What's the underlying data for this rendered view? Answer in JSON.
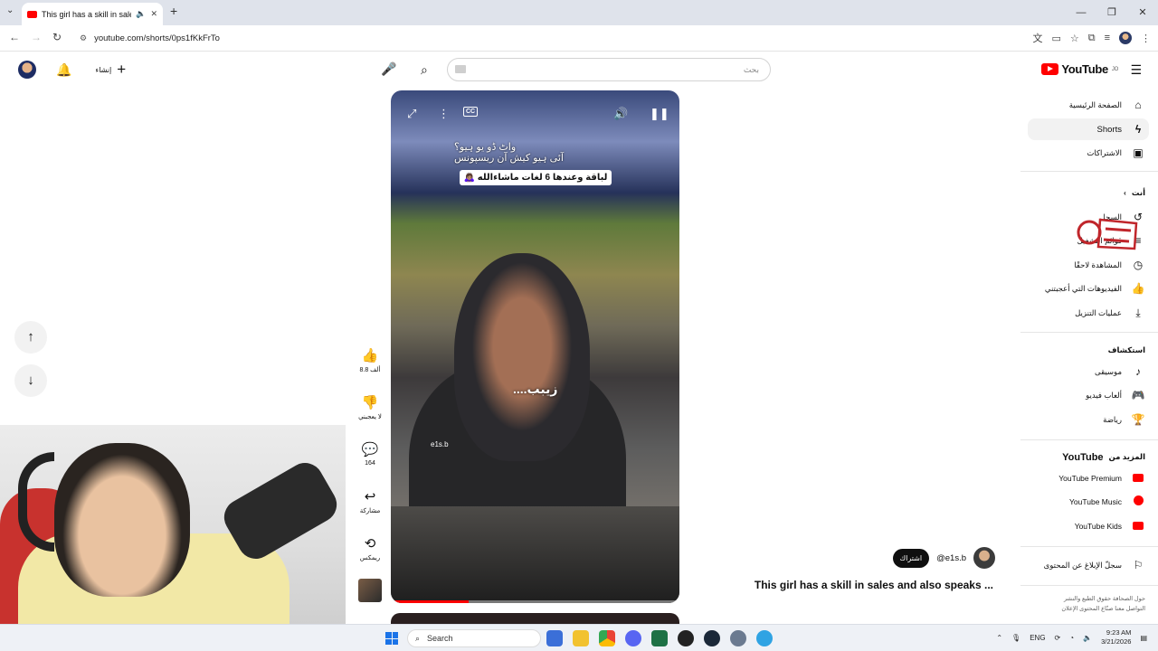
{
  "browser": {
    "tab_title": "This girl has a skill in sales a",
    "url": "youtube.com/shorts/0ps1fKkFrTo",
    "new_tab": "+",
    "window": {
      "minimize": "—",
      "restore": "❐",
      "close": "✕"
    }
  },
  "header": {
    "logo_text": "YouTube",
    "logo_region": "JO",
    "search_placeholder": "بحث",
    "create_label": "إنشاء"
  },
  "sidebar": {
    "main": [
      {
        "label": "الصفحة الرئيسية",
        "icon": "home-icon"
      },
      {
        "label": "Shorts",
        "icon": "shorts-icon",
        "active": true
      },
      {
        "label": "الاشتراكات",
        "icon": "subscriptions-icon"
      }
    ],
    "you_heading": "أنت",
    "you": [
      {
        "label": "السجل",
        "icon": "history-icon"
      },
      {
        "label": "قوائم التشغيل",
        "icon": "playlists-icon"
      },
      {
        "label": "المشاهدة لاحقًا",
        "icon": "watch-later-icon"
      },
      {
        "label": "الفيديوهات التي أعجبتني",
        "icon": "liked-icon"
      },
      {
        "label": "عمليات التنزيل",
        "icon": "download-icon"
      }
    ],
    "explore_heading": "استكشاف",
    "explore": [
      {
        "label": "موسيقى",
        "icon": "music-icon"
      },
      {
        "label": "ألعاب فيديو",
        "icon": "gaming-icon"
      },
      {
        "label": "رياضة",
        "icon": "sports-icon"
      }
    ],
    "more_heading_prefix": "المزيد من",
    "more_heading_brand": "YouTube",
    "more": [
      {
        "label": "YouTube Premium",
        "icon": "youtube-premium-icon"
      },
      {
        "label": "YouTube Music",
        "icon": "youtube-music-icon"
      },
      {
        "label": "YouTube Kids",
        "icon": "youtube-kids-icon"
      }
    ],
    "report_label": "سجلّ الإبلاغ عن المحتوى",
    "footer_line1": "حول  الصحافة  حقوق الطبع والنشر",
    "footer_line2": "التواصل معنا  صنّاع المحتوى  الإعلان"
  },
  "video": {
    "caption_line1": "واٹ ڈو یو ہیو؟",
    "caption_line2": "آئی ہیو کیش آن ریسپونس",
    "caption_box": "لباقة وعندها 6 لغات ماشاءالله 🙇🏽‍♀️",
    "subtitle": "زيبب....",
    "watermark": "e1s.b",
    "cc_label": "CC",
    "progress": 0.27
  },
  "actions": {
    "likes": "8.8 ألف",
    "dislike_label": "لا يعجبني",
    "comments": "164",
    "share_label": "مشاركة",
    "remix_label": "ريمكس"
  },
  "channel": {
    "subscribe_label": "اشتراك",
    "handle": "@e1s.b"
  },
  "video_title": "This girl has a skill in sales and also speaks ...",
  "taskbar": {
    "search_label": "Search",
    "language": "ENG",
    "time": "9:23 AM",
    "date": "3/21/2026"
  }
}
